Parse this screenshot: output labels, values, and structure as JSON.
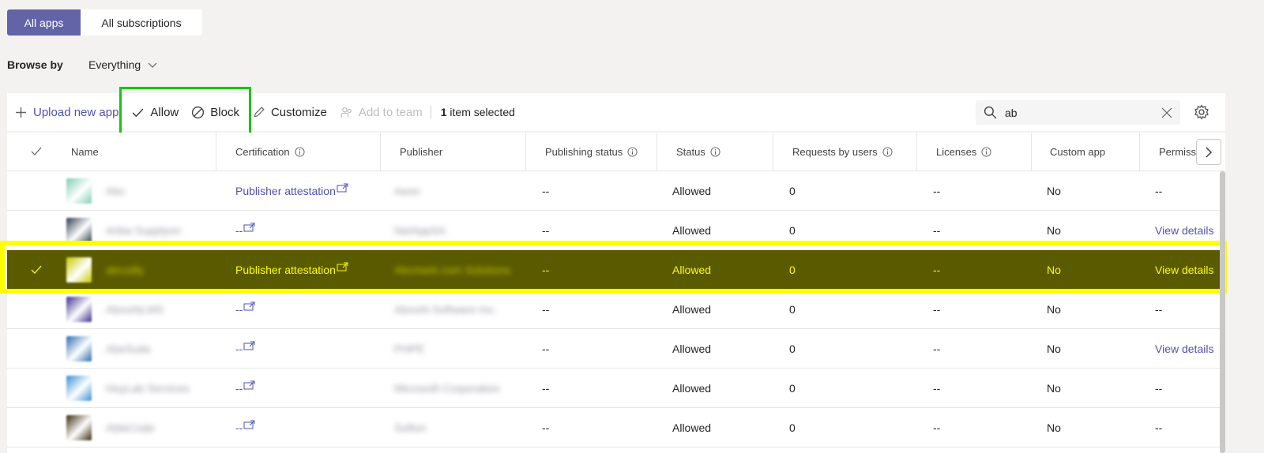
{
  "tabs": [
    {
      "label": "All apps",
      "active": true
    },
    {
      "label": "All subscriptions",
      "active": false
    }
  ],
  "browse": {
    "label": "Browse by",
    "value": "Everything"
  },
  "toolbar": {
    "upload_label": "Upload new app",
    "allow_label": "Allow",
    "block_label": "Block",
    "customize_label": "Customize",
    "add_team_label": "Add to team",
    "selected_count": "1",
    "selected_text": " item selected"
  },
  "search": {
    "value": "ab"
  },
  "columns": {
    "name": "Name",
    "certification": "Certification",
    "publisher": "Publisher",
    "publishing_status": "Publishing status",
    "status": "Status",
    "requests": "Requests by users",
    "licenses": "Licenses",
    "custom_app": "Custom app",
    "permissions": "Permissio"
  },
  "rows": [
    {
      "name": "Abc",
      "cert": "Publisher attestation",
      "publisher": "Aeon",
      "pstat": "--",
      "status": "Allowed",
      "req": "0",
      "lic": "--",
      "custom": "No",
      "perm": "--",
      "icon_color": "#7fcfb3"
    },
    {
      "name": "Ariba Supplyon",
      "cert": "--",
      "publisher": "NetAppSA",
      "pstat": "--",
      "status": "Allowed",
      "req": "0",
      "lic": "--",
      "custom": "No",
      "perm": "View details",
      "icon_color": "#2e3e4e"
    },
    {
      "name": "abcodly",
      "cert": "Publisher attestation",
      "publisher": "Abcmark.com Solutions",
      "pstat": "--",
      "status": "Allowed",
      "req": "0",
      "lic": "--",
      "custom": "No",
      "perm": "View details",
      "icon_color": "#c8c800",
      "selected": true
    },
    {
      "name": "AbsorbLMS",
      "cert": "--",
      "publisher": "Absorb Software Inc.",
      "pstat": "--",
      "status": "Allowed",
      "req": "0",
      "lic": "--",
      "custom": "No",
      "perm": "--",
      "icon_color": "#3b2f8f"
    },
    {
      "name": "AbeSuite",
      "cert": "--",
      "publisher": "PHPE",
      "pstat": "--",
      "status": "Allowed",
      "req": "0",
      "lic": "--",
      "custom": "No",
      "perm": "View details",
      "icon_color": "#2b6cb0"
    },
    {
      "name": "HeyLab Services",
      "cert": "--",
      "publisher": "Microsoft Corporation",
      "pstat": "--",
      "status": "Allowed",
      "req": "0",
      "lic": "--",
      "custom": "No",
      "perm": "--",
      "icon_color": "#3a8fd6"
    },
    {
      "name": "AbleCode",
      "cert": "--",
      "publisher": "Softon",
      "pstat": "--",
      "status": "Allowed",
      "req": "0",
      "lic": "--",
      "custom": "No",
      "perm": "--",
      "icon_color": "#3a2a10"
    }
  ],
  "colors": {
    "accent": "#6264a7",
    "link": "#4f52b2",
    "highlight": "#ffff00",
    "green_box": "#17c417"
  },
  "icons": {
    "upload": "plus-icon",
    "allow": "checkmark-icon",
    "block": "block-icon",
    "customize": "pencil-icon",
    "add_team": "people-icon",
    "search": "search-icon",
    "clear": "close-icon",
    "settings": "gear-icon",
    "scroll": "chevron-right-icon"
  }
}
